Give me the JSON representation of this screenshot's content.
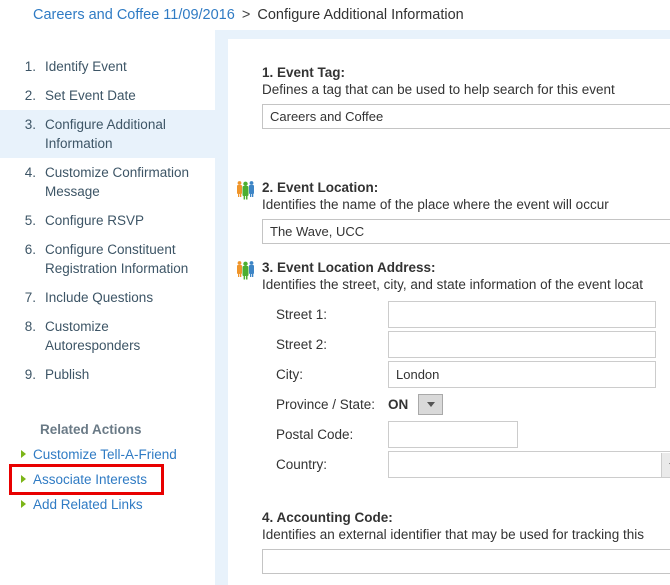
{
  "breadcrumb": {
    "event_link": "Careers and Coffee 11/09/2016",
    "separator": ">",
    "current": "Configure Additional Information"
  },
  "sidebar": {
    "steps": [
      {
        "num": "1.",
        "label": "Identify Event",
        "active": false
      },
      {
        "num": "2.",
        "label": "Set Event Date",
        "active": false
      },
      {
        "num": "3.",
        "label": "Configure Additional Information",
        "active": true
      },
      {
        "num": "4.",
        "label": "Customize Confirmation Message",
        "active": false
      },
      {
        "num": "5.",
        "label": "Configure RSVP",
        "active": false
      },
      {
        "num": "6.",
        "label": "Configure Constituent Registration Information",
        "active": false
      },
      {
        "num": "7.",
        "label": "Include Questions",
        "active": false
      },
      {
        "num": "8.",
        "label": "Customize Autoresponders",
        "active": false
      },
      {
        "num": "9.",
        "label": "Publish",
        "active": false
      }
    ],
    "related_actions_title": "Related Actions",
    "related_actions": [
      {
        "label": "Customize Tell-A-Friend",
        "highlighted": false
      },
      {
        "label": "Associate Interests",
        "highlighted": true
      },
      {
        "label": "Add Related Links",
        "highlighted": false
      }
    ]
  },
  "form": {
    "event_tag": {
      "title": "1. Event Tag:",
      "description": "Defines a tag that can be used to help search for this event",
      "value": "Careers and Coffee"
    },
    "event_location": {
      "title": "2. Event Location:",
      "description": "Identifies the name of the place where the event will occur",
      "value": "The Wave, UCC",
      "icon": "people-icon"
    },
    "event_location_address": {
      "title": "3. Event Location Address:",
      "description": "Identifies the street, city, and state information of the event locat",
      "icon": "people-icon",
      "rows": [
        {
          "label": "Street 1:",
          "value": "",
          "type": "text"
        },
        {
          "label": "Street 2:",
          "value": "",
          "type": "text"
        },
        {
          "label": "City:",
          "value": "London",
          "type": "text"
        },
        {
          "label": "Province / State:",
          "value": "ON",
          "type": "select"
        },
        {
          "label": "Postal Code:",
          "value": "",
          "type": "text"
        },
        {
          "label": "Country:",
          "value": "",
          "type": "select-wide"
        }
      ]
    },
    "accounting_code": {
      "title": "4. Accounting Code:",
      "description": "Identifies an external identifier that may be used for tracking this",
      "value": ""
    }
  },
  "colors": {
    "link": "#2f7bc4",
    "active_step_bg": "#e8f2fb",
    "panel_band": "#e8f2fb",
    "bullet_green": "#7cb518",
    "annotation_red": "#e80000"
  }
}
